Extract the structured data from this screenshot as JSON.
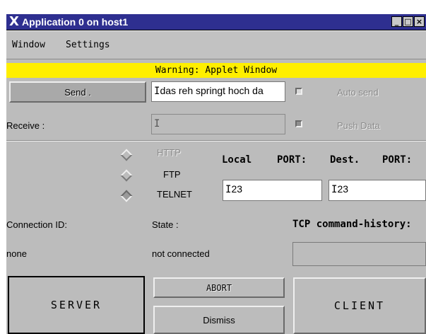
{
  "window": {
    "title": "Application 0 on host1",
    "logo": "X",
    "minimize_glyph": "_",
    "maximize_glyph": "□",
    "close_glyph": "×"
  },
  "menu": [
    "Window",
    "Settings"
  ],
  "warning": "Warning: Applet Window",
  "send": {
    "button_label": "Send .",
    "message_value": "das reh springt hoch da",
    "auto_send_label": "Auto send"
  },
  "receive": {
    "label": "Receive :",
    "value": "",
    "push_data_label": "Push Data"
  },
  "protocols": [
    {
      "label": "HTTP",
      "enabled": false,
      "selected": false
    },
    {
      "label": "FTP",
      "enabled": true,
      "selected": false
    },
    {
      "label": "TELNET",
      "enabled": true,
      "selected": true
    }
  ],
  "ports": {
    "local_label": "Local",
    "port_label_1": "PORT:",
    "dest_label": "Dest.",
    "port_label_2": "PORT:",
    "local_value": "23",
    "dest_value": "23"
  },
  "status": {
    "connection_id_label": "Connection ID:",
    "connection_id_value": "none",
    "state_label": "State :",
    "state_value": "not connected",
    "history_label": "TCP command-history:"
  },
  "buttons": {
    "server": "SERVER",
    "abort": "ABORT",
    "dismiss": "Dismiss",
    "client": "CLIENT"
  },
  "colors": {
    "titlebar": "#2e2f90",
    "warning_bg": "#ffef00",
    "panel_bg": "#bcbcbc"
  }
}
